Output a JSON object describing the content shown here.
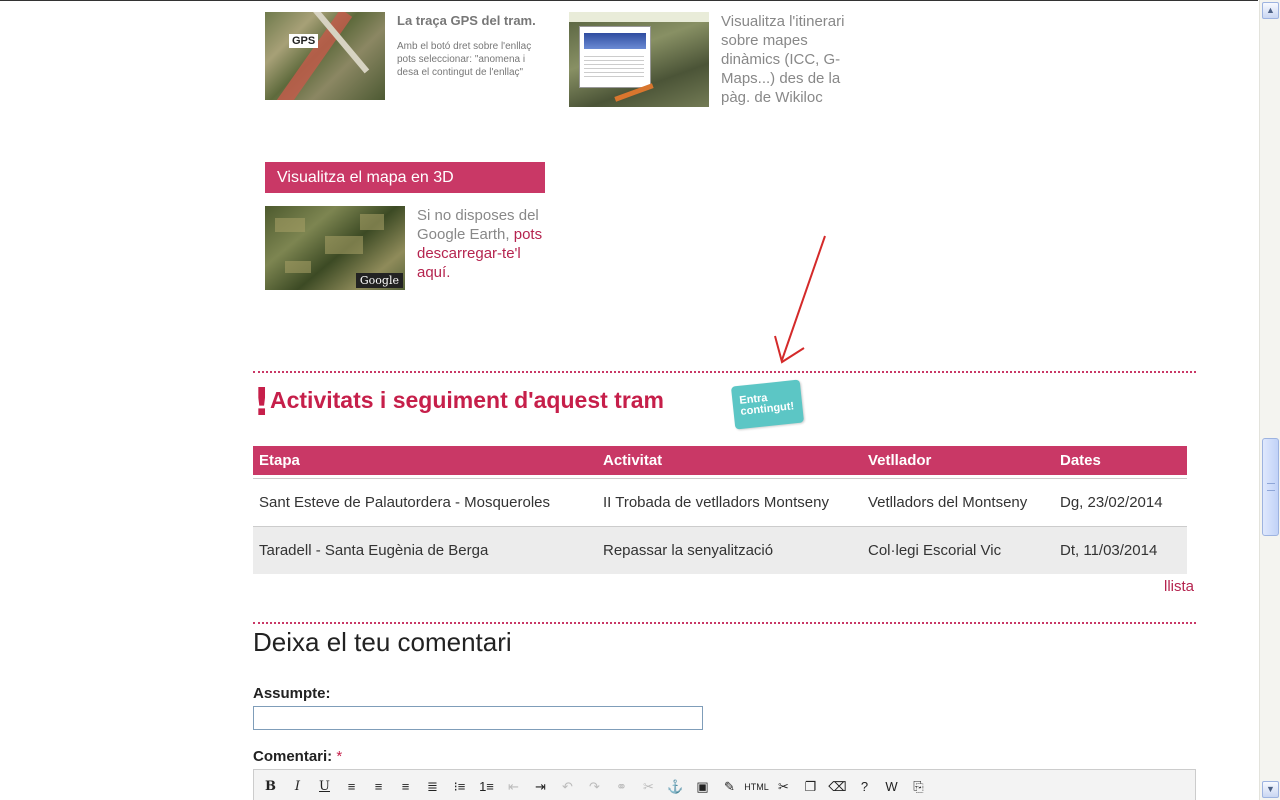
{
  "gps": {
    "title": "La traça GPS del tram.",
    "thumb_label": "GPS",
    "description": "Amb el botó dret sobre l'enllaç pots seleccionar: \"anomena i desa el contingut de l'enllaç\""
  },
  "wikiloc": {
    "description": "Visualitza l'itinerari sobre mapes dinàmics (ICC, G- Maps...) des de la pàg. de Wikiloc"
  },
  "map3d": {
    "heading": "Visualitza el mapa en 3D",
    "thumb_badge": "Google",
    "text_before": "Si no disposes del Google Earth,",
    "link": "pots descarregar-te'l aquí."
  },
  "activities": {
    "title": "Activitats i seguiment d'aquest tram",
    "sticker": "Entra contingut!",
    "columns": [
      "Etapa",
      "Activitat",
      "Vetllador",
      "Dates"
    ],
    "rows": [
      [
        "Sant Esteve de Palautordera - Mosqueroles",
        "II Trobada de vetlladors Montseny",
        "Vetlladors del Montseny",
        "Dg, 23/02/2014"
      ],
      [
        "Taradell - Santa Eugènia de Berga",
        "Repassar la senyalització",
        "Col·legi Escorial Vic",
        "Dt, 11/03/2014"
      ]
    ],
    "list_link": "llista"
  },
  "comment": {
    "title": "Deixa el teu comentari",
    "subject_label": "Assumpte:",
    "subject_value": "",
    "comment_label": "Comentari:",
    "required_mark": "*"
  },
  "toolbar": [
    {
      "name": "bold-button",
      "glyph": "B",
      "cls": "b"
    },
    {
      "name": "italic-button",
      "glyph": "I",
      "cls": "i"
    },
    {
      "name": "underline-button",
      "glyph": "U",
      "cls": "u"
    },
    {
      "name": "align-left-button",
      "glyph": "≡",
      "cls": ""
    },
    {
      "name": "align-center-button",
      "glyph": "≡",
      "cls": ""
    },
    {
      "name": "align-right-button",
      "glyph": "≡",
      "cls": ""
    },
    {
      "name": "justify-button",
      "glyph": "≣",
      "cls": ""
    },
    {
      "name": "bullet-list-button",
      "glyph": "⁝≡",
      "cls": ""
    },
    {
      "name": "numbered-list-button",
      "glyph": "1≡",
      "cls": ""
    },
    {
      "name": "outdent-button",
      "glyph": "⇤",
      "cls": "dis"
    },
    {
      "name": "indent-button",
      "glyph": "⇥",
      "cls": ""
    },
    {
      "name": "undo-button",
      "glyph": "↶",
      "cls": "dis"
    },
    {
      "name": "redo-button",
      "glyph": "↷",
      "cls": "dis"
    },
    {
      "name": "link-button",
      "glyph": "⚭",
      "cls": "dis"
    },
    {
      "name": "unlink-button",
      "glyph": "✂",
      "cls": "dis"
    },
    {
      "name": "anchor-button",
      "glyph": "⚓",
      "cls": ""
    },
    {
      "name": "image-button",
      "glyph": "▣",
      "cls": ""
    },
    {
      "name": "cleanup-button",
      "glyph": "✎",
      "cls": ""
    },
    {
      "name": "html-button",
      "glyph": "HTML",
      "cls": ""
    },
    {
      "name": "cut-button",
      "glyph": "✂",
      "cls": ""
    },
    {
      "name": "copy-button",
      "glyph": "❐",
      "cls": ""
    },
    {
      "name": "erase-button",
      "glyph": "⌫",
      "cls": ""
    },
    {
      "name": "help-button",
      "glyph": "?",
      "cls": ""
    },
    {
      "name": "paste-word-button",
      "glyph": "W",
      "cls": ""
    },
    {
      "name": "page-break-button",
      "glyph": "⎘",
      "cls": ""
    }
  ]
}
